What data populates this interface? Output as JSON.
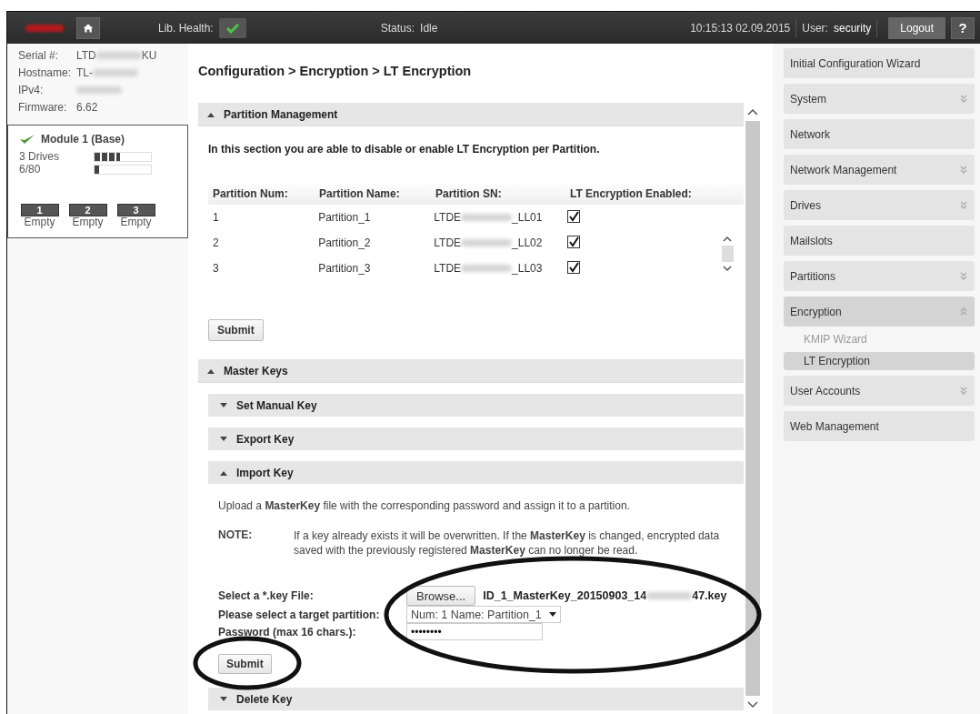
{
  "header": {
    "health_label": "Lib. Health:",
    "health_ok": true,
    "status_label": "Status:",
    "status": "Idle",
    "time": "10:15:13  02.09.2015",
    "user_label": "User:",
    "user": "security",
    "logout": "Logout",
    "help": "?"
  },
  "info": [
    {
      "label": "Serial #:",
      "prefix": "LTD",
      "masked": true,
      "suffix": "KU"
    },
    {
      "label": "Hostname:",
      "prefix": "TL-",
      "masked": true
    },
    {
      "label": "IPv4:",
      "masked": true
    },
    {
      "label": "Firmware:",
      "prefix": "6.62",
      "masked": false
    }
  ],
  "module": {
    "title": "Module 1 (Base)",
    "ok": true,
    "meters": [
      {
        "label": "3 Drives",
        "level": 0.45
      },
      {
        "label": "6/80",
        "level": 0.08
      }
    ],
    "slots": [
      {
        "number": "1",
        "label": "Empty"
      },
      {
        "number": "2",
        "label": "Empty"
      },
      {
        "number": "3",
        "label": "Empty"
      }
    ]
  },
  "breadcrumb": "Configuration > Encryption > LT Encryption",
  "partition_management": {
    "title": "Partition Management",
    "expanded": true,
    "intro": "In this section you are able to disable or enable LT Encryption per Partition.",
    "columns": [
      "Partition Num:",
      "Partition Name:",
      "Partition SN:",
      "LT Encryption Enabled:"
    ],
    "rows": [
      {
        "num": "1",
        "name": "Partition_1",
        "sn_prefix": "LTDE",
        "sn_suffix": "_LL01",
        "enabled": true
      },
      {
        "num": "2",
        "name": "Partition_2",
        "sn_prefix": "LTDE",
        "sn_suffix": "_LL02",
        "enabled": true
      },
      {
        "num": "3",
        "name": "Partition_3",
        "sn_prefix": "LTDE",
        "sn_suffix": "_LL03",
        "enabled": true
      }
    ],
    "submit": "Submit"
  },
  "master_keys": {
    "title": "Master Keys",
    "expanded": true,
    "subsections": [
      {
        "title": "Set Manual Key",
        "expanded": false
      },
      {
        "title": "Export Key",
        "expanded": false
      },
      {
        "title": "Import Key",
        "expanded": true
      },
      {
        "title": "Delete Key",
        "expanded": false
      }
    ],
    "import_key": {
      "intro": "Upload a **MasterKey** file with the corresponding password and assign it to a partition.",
      "note_label": "NOTE:",
      "note": "If a key already exists it will be overwritten. If the **MasterKey** is changed, encrypted data saved with the previously registered **MasterKey** can no longer be read.",
      "file_label": "Select a *.key File:",
      "browse": "Browse...",
      "file_prefix": "ID_1_MasterKey_20150903_14",
      "file_suffix": "47.key",
      "partition_label": "Please select a target partition:",
      "partition_value": "Num: 1 Name: Partition_1",
      "password_label": "Password (max 16 chars.):",
      "password_value": "••••••••",
      "submit": "Submit"
    }
  },
  "nav": [
    {
      "label": "Initial Configuration Wizard",
      "expandable": false,
      "expanded": false
    },
    {
      "label": "System",
      "expandable": true,
      "expanded": false
    },
    {
      "label": "Network",
      "expandable": false,
      "expanded": false
    },
    {
      "label": "Network Management",
      "expandable": true,
      "expanded": false
    },
    {
      "label": "Drives",
      "expandable": true,
      "expanded": false
    },
    {
      "label": "Mailslots",
      "expandable": false,
      "expanded": false
    },
    {
      "label": "Partitions",
      "expandable": true,
      "expanded": false
    },
    {
      "label": "Encryption",
      "expandable": true,
      "expanded": true,
      "children": [
        {
          "label": "KMIP Wizard",
          "selected": false
        },
        {
          "label": "LT Encryption",
          "selected": true
        }
      ]
    },
    {
      "label": "User Accounts",
      "expandable": true,
      "expanded": false
    },
    {
      "label": "Web Management",
      "expandable": false,
      "expanded": false
    }
  ]
}
